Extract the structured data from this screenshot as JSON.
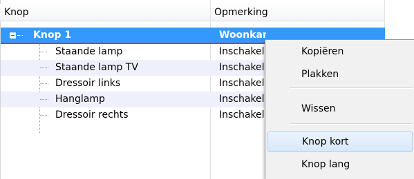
{
  "columns": [
    "Knop",
    "Opmerking"
  ],
  "rows": [
    {
      "name": "Knop 1",
      "remark": "Woonkamer aan",
      "selected": true
    },
    {
      "name": "Staande lamp",
      "remark": "Inschakelen"
    },
    {
      "name": "Staande lamp TV",
      "remark": "Inschakelen"
    },
    {
      "name": "Dressoir links",
      "remark": "Inschakelen"
    },
    {
      "name": "Hanglamp",
      "remark": "Inschakelen"
    },
    {
      "name": "Dressoir rechts",
      "remark": "Inschakelen"
    }
  ],
  "context_menu": {
    "items": [
      {
        "label": "Kopiëren"
      },
      {
        "label": "Plakken"
      },
      {
        "label": "Wissen"
      },
      {
        "label": "Knop kort",
        "hovered": true
      },
      {
        "label": "Knop lang"
      }
    ]
  },
  "colors": {
    "selection": "#3399ff",
    "selection_border": "#e0303b",
    "alternate_row": "#eef0fb",
    "menu_background": "#f1f1f1",
    "menu_hover": "#d8e8fa"
  },
  "icons": {
    "expand": "minus-box-icon",
    "tree": "dotted-tree-lines"
  }
}
